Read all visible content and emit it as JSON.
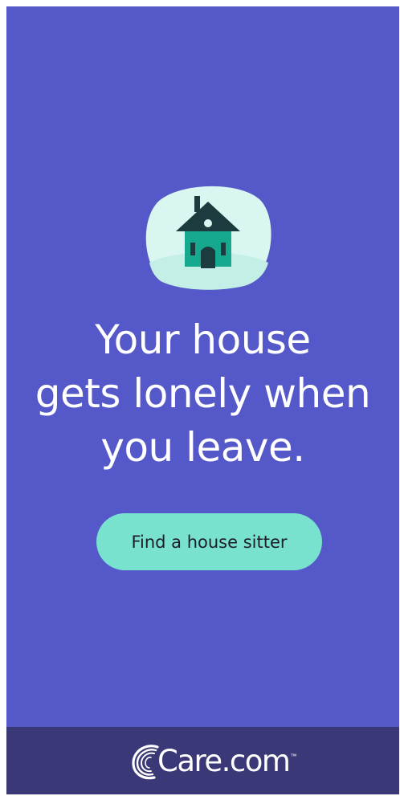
{
  "ad": {
    "icon": "house-icon",
    "headline_lines": [
      "Your house",
      "gets lonely when",
      "you leave."
    ],
    "cta_label": "Find a house sitter"
  },
  "footer": {
    "brand_icon": "care-logo-icon",
    "brand_text": "Care.com",
    "trademark": "™"
  },
  "colors": {
    "background": "#5458c9",
    "footer": "#3a3876",
    "cta": "#78e2cf",
    "house": "#16a98f",
    "roof": "#1b3b3f"
  }
}
